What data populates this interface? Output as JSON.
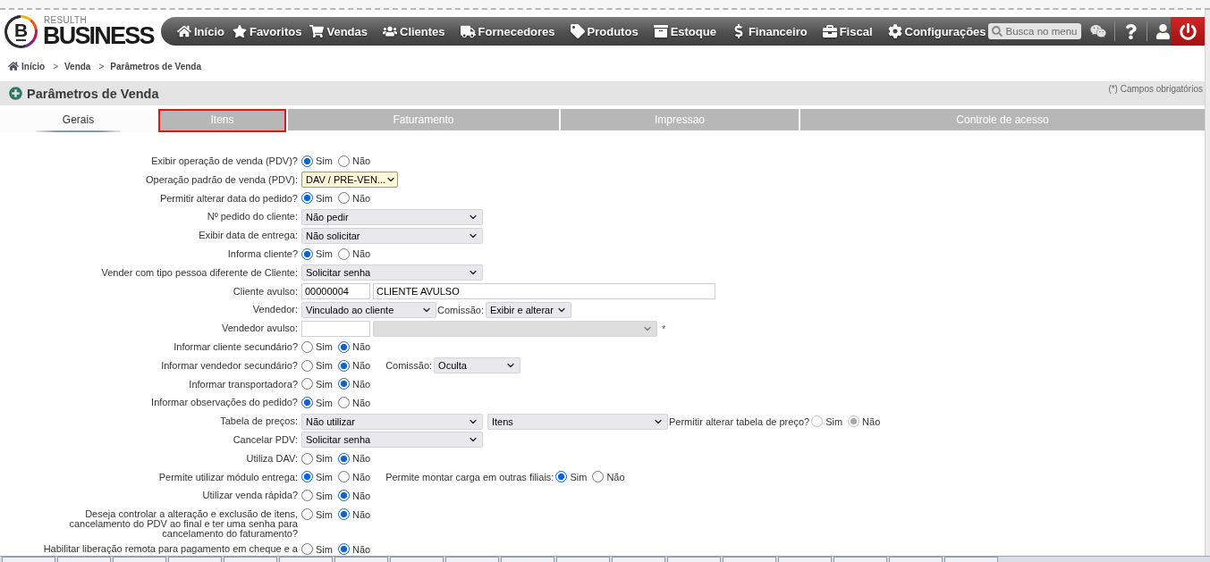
{
  "logo": {
    "letter": "B",
    "tagline": "RESULTH",
    "name": "BUSINESS"
  },
  "nav": {
    "items": [
      {
        "label": "Início"
      },
      {
        "label": "Favoritos"
      },
      {
        "label": "Vendas"
      },
      {
        "label": "Clientes"
      },
      {
        "label": "Fornecedores"
      },
      {
        "label": "Produtos"
      },
      {
        "label": "Estoque"
      },
      {
        "label": "Financeiro"
      },
      {
        "label": "Fiscal"
      },
      {
        "label": "Configurações"
      }
    ],
    "search": {
      "placeholder": "Busca no menu"
    }
  },
  "breadcrumb": [
    {
      "label": "Início"
    },
    {
      "separator": ">",
      "label": "Venda"
    },
    {
      "separator": ">",
      "label": "Parâmetros de Venda"
    }
  ],
  "panel": {
    "title": "Parâmetros de Venda",
    "note": "(*) Campos obrigatórios"
  },
  "tabs": [
    {
      "label": "Gerais",
      "selected": true,
      "highlighted": false
    },
    {
      "label": "Itens",
      "selected": false,
      "highlighted": true
    },
    {
      "label": "Faturamento",
      "selected": false,
      "highlighted": false
    },
    {
      "label": "Impressao",
      "selected": false,
      "highlighted": false
    },
    {
      "label": "Controle de acesso",
      "selected": false,
      "highlighted": false
    }
  ],
  "form": {
    "rows": [
      {
        "label": "Exibir operação de venda (PDV)?",
        "controls": [
          {
            "kind": "radio",
            "disabled": false,
            "options": [
              {
                "label": "Sim",
                "selected": true
              },
              {
                "label": "Não",
                "selected": false
              }
            ]
          }
        ]
      },
      {
        "label": "Operação padrão de venda (PDV):",
        "controls": [
          {
            "kind": "select",
            "value": "DAV / PRE-VEN...",
            "highlighted": true,
            "disabled": false
          }
        ]
      },
      {
        "label": "Permitir alterar data do pedido?",
        "controls": [
          {
            "kind": "radio",
            "disabled": false,
            "options": [
              {
                "label": "Sim",
                "selected": true
              },
              {
                "label": "Não",
                "selected": false
              }
            ]
          }
        ]
      },
      {
        "label": "Nº pedido do cliente:",
        "controls": [
          {
            "kind": "select",
            "value": "Não pedir",
            "highlighted": false,
            "disabled": false
          }
        ]
      },
      {
        "label": "Exibir data de entrega:",
        "controls": [
          {
            "kind": "select",
            "value": "Não solicitar",
            "highlighted": false,
            "disabled": false
          }
        ]
      },
      {
        "label": "Informa cliente?",
        "controls": [
          {
            "kind": "radio",
            "disabled": false,
            "options": [
              {
                "label": "Sim",
                "selected": true
              },
              {
                "label": "Não",
                "selected": false
              }
            ]
          }
        ]
      },
      {
        "label": "Vender com tipo pessoa diferente de Cliente:",
        "controls": [
          {
            "kind": "select",
            "value": "Solicitar senha",
            "highlighted": false,
            "disabled": false
          }
        ]
      },
      {
        "label": "Cliente avulso:",
        "controls": [
          {
            "kind": "input",
            "value": "00000004"
          },
          {
            "kind": "input",
            "value": "CLIENTE AVULSO"
          }
        ]
      },
      {
        "label": "Vendedor:",
        "controls": [
          {
            "kind": "select",
            "value": "Vinculado ao cliente",
            "highlighted": false,
            "disabled": false
          },
          {
            "kind": "text",
            "text": "Comissão:"
          },
          {
            "kind": "select",
            "value": "Exibir e alterar",
            "highlighted": false,
            "disabled": false
          }
        ]
      },
      {
        "label": "Vendedor avulso:",
        "controls": [
          {
            "kind": "input"
          },
          {
            "kind": "select",
            "highlighted": false,
            "disabled": true
          },
          {
            "kind": "required_mark",
            "text": "*"
          }
        ]
      },
      {
        "label": "Informar cliente secundário?",
        "controls": [
          {
            "kind": "radio",
            "disabled": false,
            "options": [
              {
                "label": "Sim",
                "selected": false
              },
              {
                "label": "Não",
                "selected": true
              }
            ]
          }
        ]
      },
      {
        "label": "Informar vendedor secundário?",
        "controls": [
          {
            "kind": "radio",
            "disabled": false,
            "options": [
              {
                "label": "Sim",
                "selected": false
              },
              {
                "label": "Não",
                "selected": true
              }
            ]
          },
          {
            "kind": "text",
            "text": "Comissão:"
          },
          {
            "kind": "select",
            "value": "Oculta",
            "highlighted": false,
            "disabled": false
          }
        ]
      },
      {
        "label": "Informar transportadora?",
        "controls": [
          {
            "kind": "radio",
            "disabled": false,
            "options": [
              {
                "label": "Sim",
                "selected": false
              },
              {
                "label": "Não",
                "selected": true
              }
            ]
          }
        ]
      },
      {
        "label": "Informar observações do pedido?",
        "controls": [
          {
            "kind": "radio",
            "disabled": false,
            "options": [
              {
                "label": "Sim",
                "selected": true
              },
              {
                "label": "Não",
                "selected": false
              }
            ]
          }
        ]
      },
      {
        "label": "Tabela de preços:",
        "controls": [
          {
            "kind": "select",
            "value": "Não utilizar",
            "highlighted": false,
            "disabled": false
          },
          {
            "kind": "select",
            "value": "Itens",
            "highlighted": false,
            "disabled": false
          },
          {
            "kind": "text",
            "text": "Permitir alterar tabela de preço?"
          },
          {
            "kind": "radio",
            "disabled": true,
            "options": [
              {
                "label": "Sim",
                "selected": false
              },
              {
                "label": "Não",
                "selected": true
              }
            ]
          }
        ]
      },
      {
        "label": "Cancelar PDV:",
        "controls": [
          {
            "kind": "select",
            "value": "Solicitar senha",
            "highlighted": false,
            "disabled": false
          }
        ]
      },
      {
        "label": "Utiliza DAV:",
        "controls": [
          {
            "kind": "radio",
            "disabled": false,
            "options": [
              {
                "label": "Sim",
                "selected": false
              },
              {
                "label": "Não",
                "selected": true
              }
            ]
          }
        ]
      },
      {
        "label": "Permite utilizar módulo entrega:",
        "controls": [
          {
            "kind": "radio",
            "disabled": false,
            "options": [
              {
                "label": "Sim",
                "selected": true
              },
              {
                "label": "Não",
                "selected": false
              }
            ]
          },
          {
            "kind": "text",
            "text": "Permite montar carga em outras filiais:"
          },
          {
            "kind": "radio",
            "disabled": false,
            "options": [
              {
                "label": "Sim",
                "selected": true
              },
              {
                "label": "Não",
                "selected": false
              }
            ]
          }
        ]
      },
      {
        "label": "Utilizar venda rápida?",
        "controls": [
          {
            "kind": "radio",
            "disabled": false,
            "options": [
              {
                "label": "Sim",
                "selected": false
              },
              {
                "label": "Não",
                "selected": true
              }
            ]
          }
        ]
      },
      {
        "label": "Deseja controlar a alteração e exclusão de itens, cancelamento do PDV ao final e ter uma senha para cancelamento do faturamento?",
        "controls": [
          {
            "kind": "radio",
            "disabled": false,
            "options": [
              {
                "label": "Sim",
                "selected": false
              },
              {
                "label": "Não",
                "selected": true
              }
            ]
          }
        ]
      },
      {
        "label": "Habilitar liberação remota para pagamento em cheque e a",
        "controls": [
          {
            "kind": "radio",
            "disabled": false,
            "options": [
              {
                "label": "Sim",
                "selected": false
              },
              {
                "label": "Não",
                "selected": true
              }
            ]
          }
        ]
      }
    ]
  }
}
